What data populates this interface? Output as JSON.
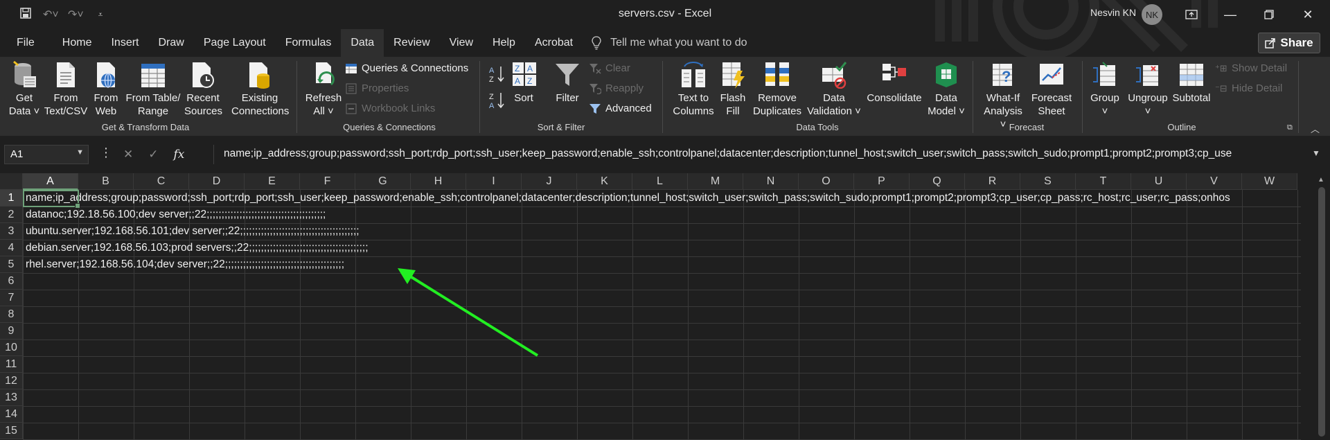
{
  "title_bar": {
    "title": "servers.csv  -  Excel",
    "user_name": "Nesvin KN",
    "user_initials": "NK"
  },
  "ribbon_tabs": [
    "File",
    "Home",
    "Insert",
    "Draw",
    "Page Layout",
    "Formulas",
    "Data",
    "Review",
    "View",
    "Help",
    "Acrobat"
  ],
  "active_tab": "Data",
  "tell_me": "Tell me what you want to do",
  "share_label": "Share",
  "groups": {
    "get_transform": {
      "label": "Get & Transform Data",
      "get_data": [
        "Get",
        "Data ˅"
      ],
      "from_text": [
        "From",
        "Text/CSV"
      ],
      "from_web": [
        "From",
        "Web"
      ],
      "from_table": [
        "From Table/",
        "Range"
      ],
      "recent_sources": [
        "Recent",
        "Sources"
      ],
      "existing_connections": [
        "Existing",
        "Connections"
      ]
    },
    "queries": {
      "label": "Queries & Connections",
      "refresh_all": [
        "Refresh",
        "All ˅"
      ],
      "queries_connections": "Queries & Connections",
      "properties": "Properties",
      "workbook_links": "Workbook Links"
    },
    "sort_filter": {
      "label": "Sort & Filter",
      "sort": "Sort",
      "filter": "Filter",
      "clear": "Clear",
      "reapply": "Reapply",
      "advanced": "Advanced"
    },
    "data_tools": {
      "label": "Data Tools",
      "text_to_columns": [
        "Text to",
        "Columns"
      ],
      "flash_fill": [
        "Flash",
        "Fill"
      ],
      "remove_duplicates": [
        "Remove",
        "Duplicates"
      ],
      "data_validation": [
        "Data",
        "Validation ˅"
      ],
      "consolidate": "Consolidate",
      "data_model": [
        "Data",
        "Model ˅"
      ]
    },
    "forecast": {
      "label": "Forecast",
      "what_if": [
        "What-If",
        "Analysis ˅"
      ],
      "forecast_sheet": [
        "Forecast",
        "Sheet"
      ]
    },
    "outline": {
      "label": "Outline",
      "group": [
        "Group",
        "˅"
      ],
      "ungroup": [
        "Ungroup",
        "˅"
      ],
      "subtotal": "Subtotal",
      "show_detail": "Show Detail",
      "hide_detail": "Hide Detail"
    }
  },
  "formula_bar": {
    "name_box": "A1",
    "content": "name;ip_address;group;password;ssh_port;rdp_port;ssh_user;keep_password;enable_ssh;controlpanel;datacenter;description;tunnel_host;switch_user;switch_pass;switch_sudo;prompt1;prompt2;prompt3;cp_use"
  },
  "columns": [
    "A",
    "B",
    "C",
    "D",
    "E",
    "F",
    "G",
    "H",
    "I",
    "J",
    "K",
    "L",
    "M",
    "N",
    "O",
    "P",
    "Q",
    "R",
    "S",
    "T",
    "U",
    "V",
    "W"
  ],
  "rows": [
    "1",
    "2",
    "3",
    "4",
    "5",
    "6",
    "7",
    "8",
    "9",
    "10",
    "11",
    "12",
    "13",
    "14",
    "15"
  ],
  "cells": [
    "name;ip_address;group;password;ssh_port;rdp_port;ssh_user;keep_password;enable_ssh;controlpanel;datacenter;description;tunnel_host;switch_user;switch_pass;switch_sudo;prompt1;prompt2;prompt3;cp_user;cp_pass;rc_host;rc_user;rc_pass;onhos",
    "datanoc;192.18.56.100;dev server;;22;;;;;;;;;;;;;;;;;;;;;;;;;;;;;;;;;;;;;;;;",
    "ubuntu.server;192.168.56.101;dev server;;22;;;;;;;;;;;;;;;;;;;;;;;;;;;;;;;;;;;;;;;;",
    "debian.server;192.168.56.103;prod servers;;22;;;;;;;;;;;;;;;;;;;;;;;;;;;;;;;;;;;;;;;;",
    "rhel.server;192.168.56.104;dev server;;22;;;;;;;;;;;;;;;;;;;;;;;;;;;;;;;;;;;;;;;;"
  ],
  "colors": {
    "arrow": "#22ee22",
    "selection": "#6fa27a",
    "background": "#1f1f1f",
    "ribbon": "#2f2f2f"
  }
}
